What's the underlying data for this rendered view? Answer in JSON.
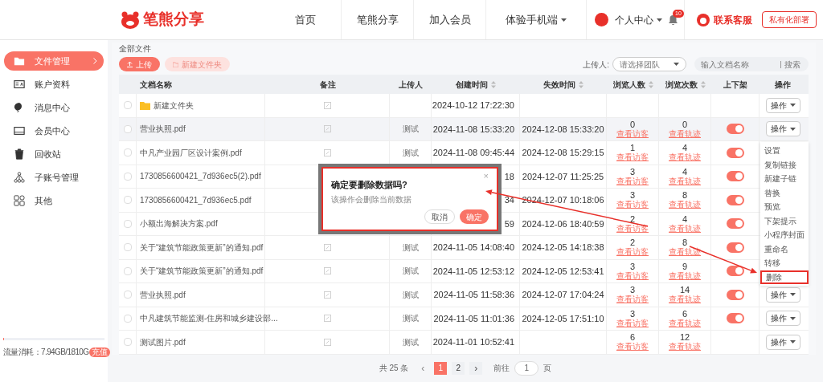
{
  "header": {
    "logo": "笔熊分享",
    "nav": [
      {
        "label": "首页",
        "dropdown": false
      },
      {
        "label": "笔熊分享",
        "dropdown": false
      },
      {
        "label": "加入会员",
        "dropdown": false
      },
      {
        "label": "体验手机端",
        "dropdown": true
      }
    ],
    "user": "个人中心",
    "notifications": "10",
    "service": "联系客服",
    "deploy": "私有化部署"
  },
  "sidebar": {
    "items": [
      {
        "label": "文件管理",
        "selected": true
      },
      {
        "label": "账户资料",
        "selected": false
      },
      {
        "label": "消息中心",
        "selected": false
      },
      {
        "label": "会员中心",
        "selected": false
      },
      {
        "label": "回收站",
        "selected": false
      },
      {
        "label": "子账号管理",
        "selected": false
      },
      {
        "label": "其他",
        "selected": false
      }
    ],
    "usage": {
      "text": "流量消耗：7.94GB/1810G",
      "level": 0.005,
      "badge": "充值"
    }
  },
  "breadcrumb": "全部文件",
  "toolbar": {
    "upload": "上传",
    "new_folder": "新建文件夹",
    "uploader_label": "上传人:",
    "uploader_placeholder": "请选择团队",
    "search_placeholder": "输入文档名称",
    "search_button": "搜索"
  },
  "table": {
    "columns": [
      {
        "label": "文档名称",
        "sortable": false
      },
      {
        "label": "备注",
        "sortable": false
      },
      {
        "label": "上传人",
        "sortable": false
      },
      {
        "label": "创建时间",
        "sortable": true
      },
      {
        "label": "失效时间",
        "sortable": true
      },
      {
        "label": "浏览人数",
        "sortable": true
      },
      {
        "label": "浏览次数",
        "sortable": true
      },
      {
        "label": "上下架",
        "sortable": false
      },
      {
        "label": "操作",
        "sortable": false
      }
    ],
    "rows": [
      {
        "checked": false,
        "selected": false,
        "kind": "folder",
        "name": "新建文件夹",
        "remark": true,
        "created": "2024-10-12 17:22:30",
        "action": "操作"
      },
      {
        "checked": false,
        "selected": true,
        "kind": "file",
        "name": "营业执照.pdf",
        "remark": true,
        "uploader": "测试",
        "created": "2024-11-08 15:33:20",
        "expires": "2024-12-08 15:33:20",
        "visitors": "0",
        "visitors_link": "查看访客",
        "views": "0",
        "views_link": "查看轨迹",
        "on": true,
        "action": "操作"
      },
      {
        "checked": false,
        "selected": false,
        "kind": "file",
        "name": "中凡产业园厂区设计案例.pdf",
        "remark": true,
        "uploader": "测试",
        "created": "2024-11-08 09:45:44",
        "expires": "2024-12-08 15:29:15",
        "visitors": "1",
        "visitors_link": "查看访客",
        "views": "4",
        "views_link": "查看轨迹",
        "on": true
      },
      {
        "checked": false,
        "selected": false,
        "kind": "file",
        "name": "1730856600421_7d936ec5(2).pdf",
        "created": "18",
        "expires": "2024-12-07 11:25:25",
        "visitors": "3",
        "visitors_link": "查看访客",
        "views": "4",
        "views_link": "查看轨迹",
        "on": true
      },
      {
        "checked": false,
        "selected": false,
        "kind": "file",
        "name": "1730856600421_7d936ec5.pdf",
        "created": "34",
        "expires": "2024-12-07 10:18:06",
        "visitors": "3",
        "visitors_link": "查看访客",
        "views": "8",
        "views_link": "查看轨迹",
        "on": true
      },
      {
        "checked": false,
        "selected": false,
        "kind": "file",
        "name": "小额出海解决方案.pdf",
        "created": "59",
        "expires": "2024-12-06 18:40:59",
        "visitors": "2",
        "visitors_link": "查看访客",
        "views": "4",
        "views_link": "查看轨迹",
        "on": true
      },
      {
        "checked": false,
        "selected": false,
        "kind": "file",
        "name": "关于“建筑节能政策更新”的通知.pdf",
        "remark": true,
        "uploader": "测试",
        "created": "2024-11-05 14:08:40",
        "expires": "2024-12-05 14:18:38",
        "visitors": "2",
        "visitors_link": "查看访客",
        "views": "8",
        "views_link": "查看轨迹",
        "on": true
      },
      {
        "checked": false,
        "selected": false,
        "kind": "file",
        "name": "关于“建筑节能政策更新”的通知.pdf",
        "remark": true,
        "uploader": "测试",
        "created": "2024-11-05 12:53:12",
        "expires": "2024-12-05 12:53:41",
        "visitors": "3",
        "visitors_link": "查看访客",
        "views": "9",
        "views_link": "查看轨迹",
        "on": true
      },
      {
        "checked": false,
        "selected": false,
        "kind": "file",
        "name": "营业执照.pdf",
        "remark": true,
        "uploader": "测试",
        "created": "2024-11-05 11:58:36",
        "expires": "2024-12-07 17:04:24",
        "visitors": "3",
        "visitors_link": "查看访客",
        "views": "14",
        "views_link": "查看轨迹",
        "on": true,
        "action": "操作"
      },
      {
        "checked": false,
        "selected": false,
        "kind": "file",
        "name": "中凡建筑节能监测-住房和城乡建设部...",
        "remark": true,
        "uploader": "测试",
        "created": "2024-11-05 11:01:36",
        "expires": "2024-12-05 17:51:10",
        "visitors": "3",
        "visitors_link": "查看访客",
        "views": "6",
        "views_link": "查看轨迹",
        "on": true,
        "action": "操作"
      },
      {
        "checked": false,
        "selected": false,
        "kind": "file",
        "name": "测试图片.pdf",
        "remark": true,
        "uploader": "测试",
        "created": "2024-11-01 10:52:41",
        "visitors": "6",
        "visitors_link": "查看访客",
        "views": "12",
        "views_link": "查看轨迹",
        "action": "操作"
      }
    ]
  },
  "menu": {
    "items": [
      {
        "label": "设置",
        "selected": false
      },
      {
        "label": "复制链接",
        "selected": false
      },
      {
        "label": "新建子链",
        "selected": false
      },
      {
        "label": "替换",
        "selected": false
      },
      {
        "label": "预览",
        "selected": false
      },
      {
        "label": "下架提示",
        "selected": false
      },
      {
        "label": "小程序封面",
        "selected": false
      },
      {
        "label": "重命名",
        "selected": false
      },
      {
        "label": "转移",
        "selected": false
      },
      {
        "label": "删除",
        "selected": true
      }
    ]
  },
  "dialog": {
    "title": "确定要删除数据吗?",
    "message": "该操作会删除当前数据",
    "cancel": "取消",
    "confirm": "确定",
    "close": "×"
  },
  "pagination": {
    "total": "共 25 条",
    "prev": "‹",
    "pages": [
      {
        "label": "1",
        "selected": true
      },
      {
        "label": "2",
        "selected": false
      }
    ],
    "next": "›",
    "goto": "前往",
    "page_value": "1",
    "page_suffix": "页"
  }
}
